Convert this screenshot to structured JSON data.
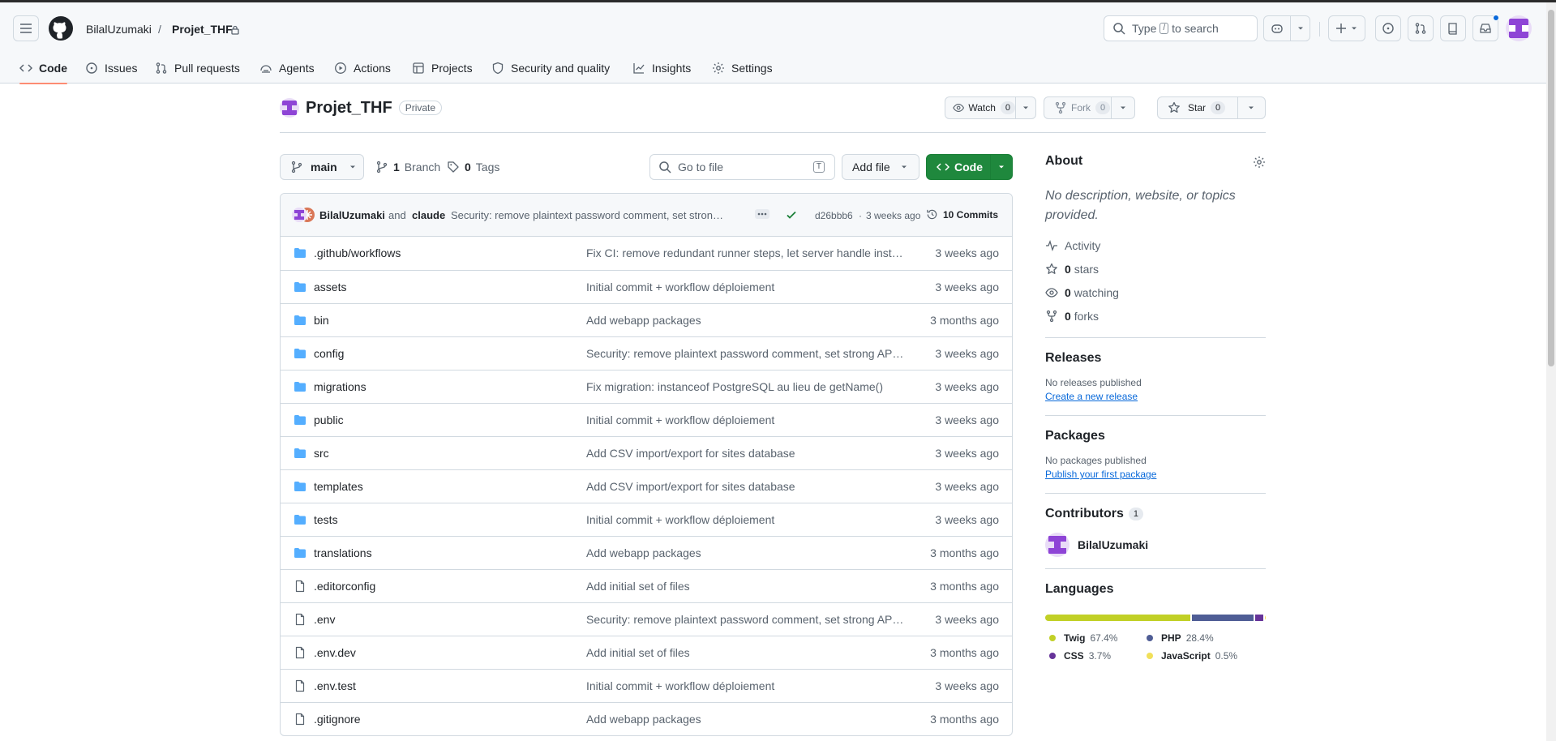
{
  "header": {
    "owner": "BilalUzumaki",
    "separator": "/",
    "repo": "Projet_THF",
    "search": {
      "prefix": "Type",
      "key": "/",
      "suffix": "to search"
    }
  },
  "tabs": [
    {
      "label": "Code",
      "icon": "code-icon",
      "active": true
    },
    {
      "label": "Issues",
      "icon": "issue-icon"
    },
    {
      "label": "Pull requests",
      "icon": "pull-request-icon"
    },
    {
      "label": "Agents",
      "icon": "agent-icon"
    },
    {
      "label": "Actions",
      "icon": "play-icon"
    },
    {
      "label": "Projects",
      "icon": "table-icon"
    },
    {
      "label": "Security and quality",
      "icon": "shield-icon"
    },
    {
      "label": "Insights",
      "icon": "graph-icon"
    },
    {
      "label": "Settings",
      "icon": "gear-icon"
    }
  ],
  "repo_head": {
    "name": "Projet_THF",
    "visibility": "Private",
    "watch": {
      "label": "Watch",
      "count": "0"
    },
    "fork": {
      "label": "Fork",
      "count": "0"
    },
    "star": {
      "label": "Star",
      "count": "0"
    }
  },
  "toolbar": {
    "branch": "main",
    "branches_count": "1",
    "branches_label": "Branch",
    "tags_count": "0",
    "tags_label": "Tags",
    "goto_placeholder": "Go to file",
    "goto_key": "T",
    "add_file": "Add file",
    "code": "Code"
  },
  "commit": {
    "author": "BilalUzumaki",
    "and": "and",
    "coauthor": "claude",
    "message": "Security: remove plaintext password comment, set stron…",
    "sha": "d26bbb6",
    "dot": "·",
    "when": "3 weeks ago",
    "commits": "10 Commits"
  },
  "files": [
    {
      "name": ".github/workflows",
      "type": "dir",
      "message": "Fix CI: remove redundant runner steps, let server handle insta…",
      "age": "3 weeks ago"
    },
    {
      "name": "assets",
      "type": "dir",
      "message": "Initial commit + workflow déploiement",
      "age": "3 weeks ago"
    },
    {
      "name": "bin",
      "type": "dir",
      "message": "Add webapp packages",
      "age": "3 months ago"
    },
    {
      "name": "config",
      "type": "dir",
      "message": "Security: remove plaintext password comment, set strong AP…",
      "age": "3 weeks ago"
    },
    {
      "name": "migrations",
      "type": "dir",
      "message": "Fix migration: instanceof PostgreSQL au lieu de getName()",
      "age": "3 weeks ago"
    },
    {
      "name": "public",
      "type": "dir",
      "message": "Initial commit + workflow déploiement",
      "age": "3 weeks ago"
    },
    {
      "name": "src",
      "type": "dir",
      "message": "Add CSV import/export for sites database",
      "age": "3 weeks ago"
    },
    {
      "name": "templates",
      "type": "dir",
      "message": "Add CSV import/export for sites database",
      "age": "3 weeks ago"
    },
    {
      "name": "tests",
      "type": "dir",
      "message": "Initial commit + workflow déploiement",
      "age": "3 weeks ago"
    },
    {
      "name": "translations",
      "type": "dir",
      "message": "Add webapp packages",
      "age": "3 months ago"
    },
    {
      "name": ".editorconfig",
      "type": "file",
      "message": "Add initial set of files",
      "age": "3 months ago"
    },
    {
      "name": ".env",
      "type": "file",
      "message": "Security: remove plaintext password comment, set strong AP…",
      "age": "3 weeks ago"
    },
    {
      "name": ".env.dev",
      "type": "file",
      "message": "Add initial set of files",
      "age": "3 months ago"
    },
    {
      "name": ".env.test",
      "type": "file",
      "message": "Initial commit + workflow déploiement",
      "age": "3 weeks ago"
    },
    {
      "name": ".gitignore",
      "type": "file",
      "message": "Add webapp packages",
      "age": "3 months ago"
    }
  ],
  "about": {
    "title": "About",
    "description": "No description, website, or topics provided.",
    "activity": "Activity",
    "stars_count": "0",
    "stars_label": "stars",
    "watching_count": "0",
    "watching_label": "watching",
    "forks_count": "0",
    "forks_label": "forks"
  },
  "releases": {
    "title": "Releases",
    "empty": "No releases published",
    "link": "Create a new release"
  },
  "packages": {
    "title": "Packages",
    "empty": "No packages published",
    "link": "Publish your first package"
  },
  "contributors": {
    "title": "Contributors",
    "count": "1",
    "name": "BilalUzumaki"
  },
  "languages": {
    "title": "Languages",
    "items": [
      {
        "name": "Twig",
        "percent": "67.4%",
        "value": 67.4,
        "color": "#c1d026"
      },
      {
        "name": "PHP",
        "percent": "28.4%",
        "value": 28.4,
        "color": "#4f5d95"
      },
      {
        "name": "CSS",
        "percent": "3.7%",
        "value": 3.7,
        "color": "#663399"
      },
      {
        "name": "JavaScript",
        "percent": "0.5%",
        "value": 0.5,
        "color": "#f1e05a"
      }
    ]
  },
  "colors": {
    "accent_green": "#1f883d",
    "link_blue": "#0969da",
    "folder_blue": "#54aeff",
    "tab_underline": "#fd8c73",
    "notification_dot": "#0969da"
  }
}
